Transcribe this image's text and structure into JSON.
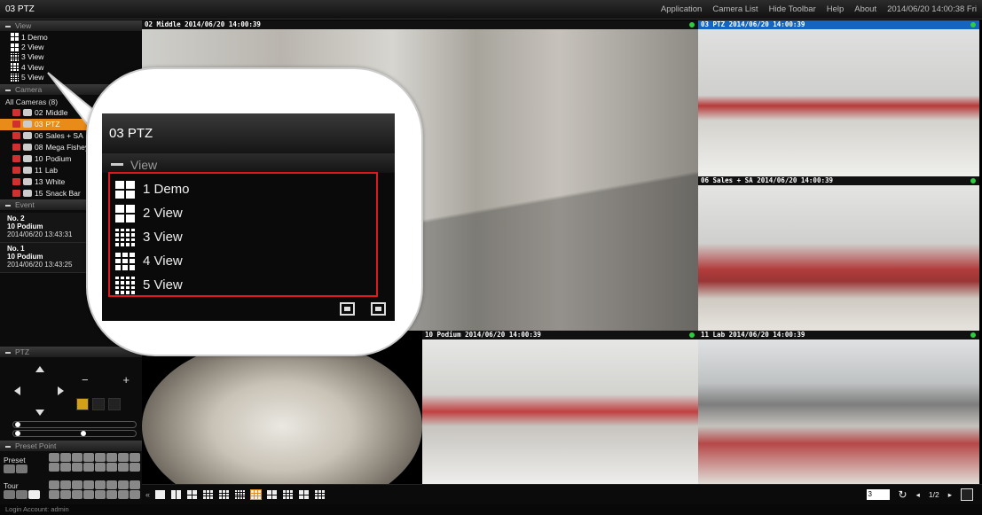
{
  "window": {
    "title": "03 PTZ",
    "menu": [
      "Application",
      "Camera List",
      "Hide Toolbar",
      "Help",
      "About"
    ],
    "datetime": "2014/06/20 14:00:38 Fri"
  },
  "sidebar": {
    "view_header": "View",
    "views": [
      "1 Demo",
      "2 View",
      "3 View",
      "4 View",
      "5 View"
    ],
    "camera_header": "Camera",
    "camera_root": "All Cameras (8)",
    "cameras": [
      {
        "num": "02",
        "name": "Middle"
      },
      {
        "num": "03",
        "name": "PTZ"
      },
      {
        "num": "06",
        "name": "Sales + SA"
      },
      {
        "num": "08",
        "name": "Mega Fisheye"
      },
      {
        "num": "10",
        "name": "Podium"
      },
      {
        "num": "11",
        "name": "Lab"
      },
      {
        "num": "13",
        "name": "White"
      },
      {
        "num": "15",
        "name": "Snack Bar"
      }
    ],
    "event_header": "Event",
    "events": [
      {
        "no": "No. 2",
        "camera": "10 Podium",
        "time": "2014/06/20 13:43:31"
      },
      {
        "no": "No. 1",
        "camera": "10 Podium",
        "time": "2014/06/20 13:43:25"
      }
    ],
    "ptz_header": "PTZ",
    "zoom_minus": "−",
    "zoom_plus": "+",
    "preset_header": "Preset Point",
    "preset_label": "Preset",
    "tour_label": "Tour"
  },
  "tiles": [
    {
      "label": "02 Middle  2014/06/20 14:00:39"
    },
    {
      "label": "03 PTZ  2014/06/20 14:00:39"
    },
    {
      "label": "06 Sales + SA  2014/06/20 14:00:39"
    },
    {
      "label": "10 Podium  2014/06/20 14:00:39"
    },
    {
      "label": "11 Lab  2014/06/20 14:00:39"
    },
    {
      "label": ""
    }
  ],
  "toolbar": {
    "page_input": "3",
    "page_indicator": "1/2"
  },
  "status": {
    "login": "Login Account: admin"
  },
  "callout": {
    "title": "03 PTZ",
    "section": "View",
    "views": [
      "1 Demo",
      "2 View",
      "3 View",
      "4 View",
      "5 View"
    ]
  },
  "colors": {
    "accent_orange": "#e88b19",
    "selected_label_blue": "#1565c0",
    "highlight_red": "#e0191f",
    "status_green": "#2ecc40"
  }
}
